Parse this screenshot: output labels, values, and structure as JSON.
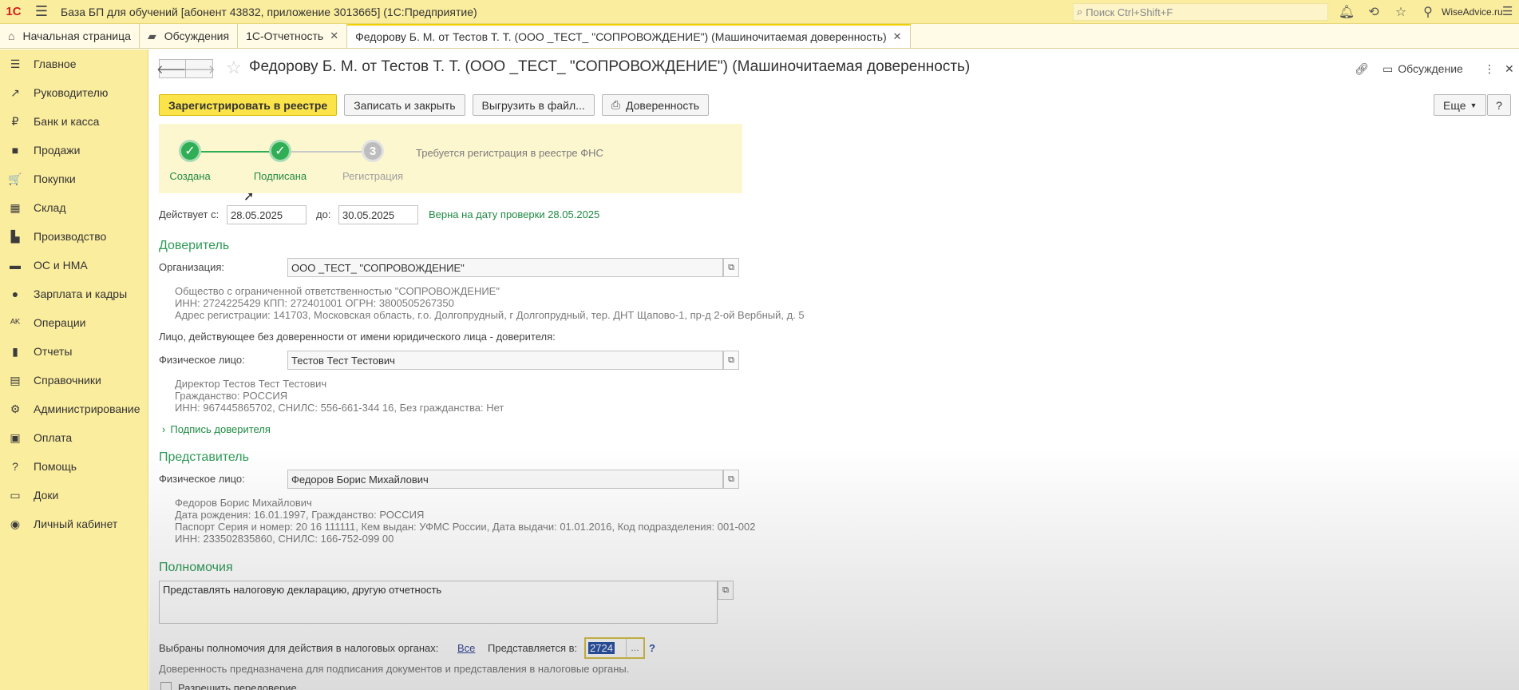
{
  "titlebar": {
    "logo": "1С",
    "title": "База БП для обучений [абонент 43832, приложение 3013665]  (1С:Предприятие)",
    "search_placeholder": "Поиск Ctrl+Shift+F",
    "user": "WiseAdvice.ru"
  },
  "tabs": [
    {
      "label": "Начальная страница",
      "icon": "home-icon"
    },
    {
      "label": "Обсуждения",
      "icon": "discussions-icon"
    },
    {
      "label": "1С-Отчетность",
      "closable": true
    },
    {
      "label": "Федорову Б. М. от Тестов Т. Т. (ООО _ТЕСТ_ \"СОПРОВОЖДЕНИЕ\") (Машиночитаемая доверенность)",
      "closable": true,
      "active": true
    }
  ],
  "sidebar": {
    "items": [
      {
        "label": "Главное",
        "icon": "menu-icon",
        "glyph": "☰"
      },
      {
        "label": "Руководителю",
        "icon": "trend-icon",
        "glyph": "↗"
      },
      {
        "label": "Банк и касса",
        "icon": "ruble-icon",
        "glyph": "₽"
      },
      {
        "label": "Продажи",
        "icon": "bag-icon",
        "glyph": "■"
      },
      {
        "label": "Покупки",
        "icon": "cart-icon",
        "glyph": "🛒"
      },
      {
        "label": "Склад",
        "icon": "warehouse-icon",
        "glyph": "▦"
      },
      {
        "label": "Производство",
        "icon": "factory-icon",
        "glyph": "▙"
      },
      {
        "label": "ОС и НМА",
        "icon": "truck-icon",
        "glyph": "▬"
      },
      {
        "label": "Зарплата и кадры",
        "icon": "person-icon",
        "glyph": "●"
      },
      {
        "label": "Операции",
        "icon": "operations-icon",
        "glyph": "ᴬᴷ"
      },
      {
        "label": "Отчеты",
        "icon": "reports-icon",
        "glyph": "▮"
      },
      {
        "label": "Справочники",
        "icon": "book-icon",
        "glyph": "▤"
      },
      {
        "label": "Администрирование",
        "icon": "gear-icon",
        "glyph": "⚙"
      },
      {
        "label": "Оплата",
        "icon": "payment-icon",
        "glyph": "▣"
      },
      {
        "label": "Помощь",
        "icon": "help-icon",
        "glyph": "?"
      },
      {
        "label": "Доки",
        "icon": "docs-icon",
        "glyph": "▭"
      },
      {
        "label": "Личный кабинет",
        "icon": "account-icon",
        "glyph": "◉"
      }
    ]
  },
  "document": {
    "title": "Федорову Б. М. от Тестов Т. Т. (ООО _ТЕСТ_ \"СОПРОВОЖДЕНИЕ\") (Машиночитаемая доверенность)",
    "discussion_label": "Обсуждение"
  },
  "toolbar": {
    "register": "Зарегистрировать в реестре",
    "save_close": "Записать и закрыть",
    "export": "Выгрузить в файл...",
    "poa": "Доверенность",
    "more": "Еще",
    "help": "?"
  },
  "steps": {
    "items": [
      {
        "label": "Создана",
        "state": "done"
      },
      {
        "label": "Подписана",
        "state": "done"
      },
      {
        "label": "Регистрация",
        "state": "todo",
        "number": "3"
      }
    ],
    "status": "Требуется регистрация в реестре ФНС"
  },
  "validity": {
    "from_label": "Действует с:",
    "from": "28.05.2025",
    "to_label": "до:",
    "to": "30.05.2025",
    "note": "Верна на дату проверки 28.05.2025"
  },
  "principal": {
    "section": "Доверитель",
    "org_label": "Организация:",
    "org": "ООО _ТЕСТ_ \"СОПРОВОЖДЕНИЕ\"",
    "org_info": [
      "Общество с ограниченной ответственностью \"СОПРОВОЖДЕНИЕ\"",
      "ИНН: 2724225429 КПП: 272401001 ОГРН: 3800505267350",
      "Адрес регистрации: 141703, Московская область, г.о. Долгопрудный, г Долгопрудный, тер. ДНТ Щапово-1, пр-д 2-ой Вербный, д. 5"
    ],
    "person_caption": "Лицо, действующее без доверенности от имени юридического лица - доверителя:",
    "person_label": "Физическое лицо:",
    "person": "Тестов Тест Тестович",
    "person_info": [
      "Директор Тестов Тест Тестович",
      "Гражданство: РОССИЯ",
      "ИНН: 967445865702, СНИЛС: 556-661-344 16, Без гражданства: Нет"
    ],
    "signature_link": "Подпись доверителя"
  },
  "representative": {
    "section": "Представитель",
    "person_label": "Физическое лицо:",
    "person": "Федоров Борис Михайлович",
    "info": [
      "Федоров Борис Михайлович",
      "Дата рождения: 16.01.1997, Гражданство: РОССИЯ",
      "Паспорт Серия и номер: 20 16 111111, Кем выдан: УФМС России, Дата выдачи: 01.01.2016, Код подразделения: 001-002",
      "ИНН: 233502835860, СНИЛС: 166-752-099 00"
    ]
  },
  "powers": {
    "section": "Полномочия",
    "text": "Представлять налоговую декларацию, другую отчетность",
    "tax_label": "Выбраны полномочия для действия в налоговых органах:",
    "all_link": "Все",
    "represented_label": "Представляется в:",
    "code": "2724",
    "question": "?",
    "note": "Доверенность предназначена для подписания документов и представления в налоговые органы.",
    "allow_label": "Разрешить передоверие"
  }
}
